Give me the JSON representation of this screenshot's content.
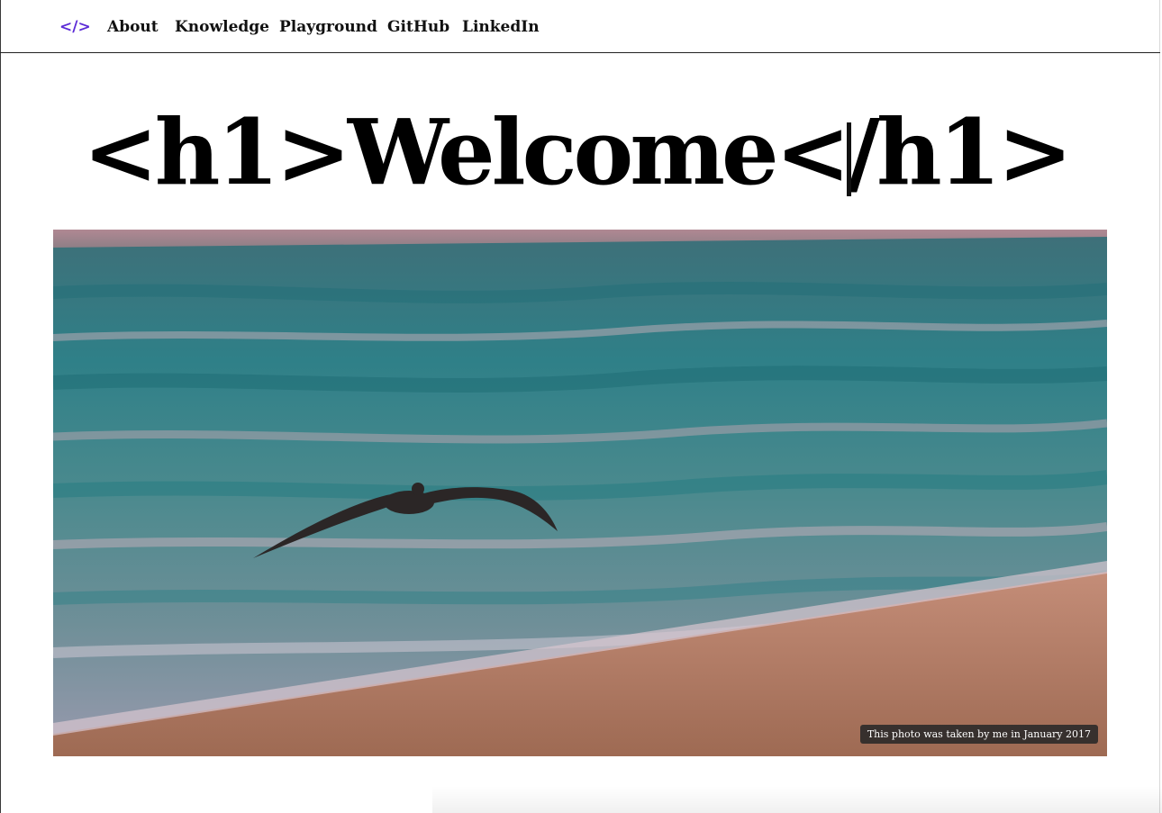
{
  "nav": {
    "logo": "</>",
    "items": [
      "About",
      "Knowledge",
      "Playground",
      "GitHub",
      "LinkedIn"
    ]
  },
  "hero": {
    "title": "<h1>Welcome</h1>"
  },
  "photo": {
    "caption": "This photo was taken by me in January 2017"
  },
  "colors": {
    "accent": "#5b2ad6",
    "sea": "#2f7f86",
    "sand": "#b07a62",
    "sky": "#a98696"
  }
}
